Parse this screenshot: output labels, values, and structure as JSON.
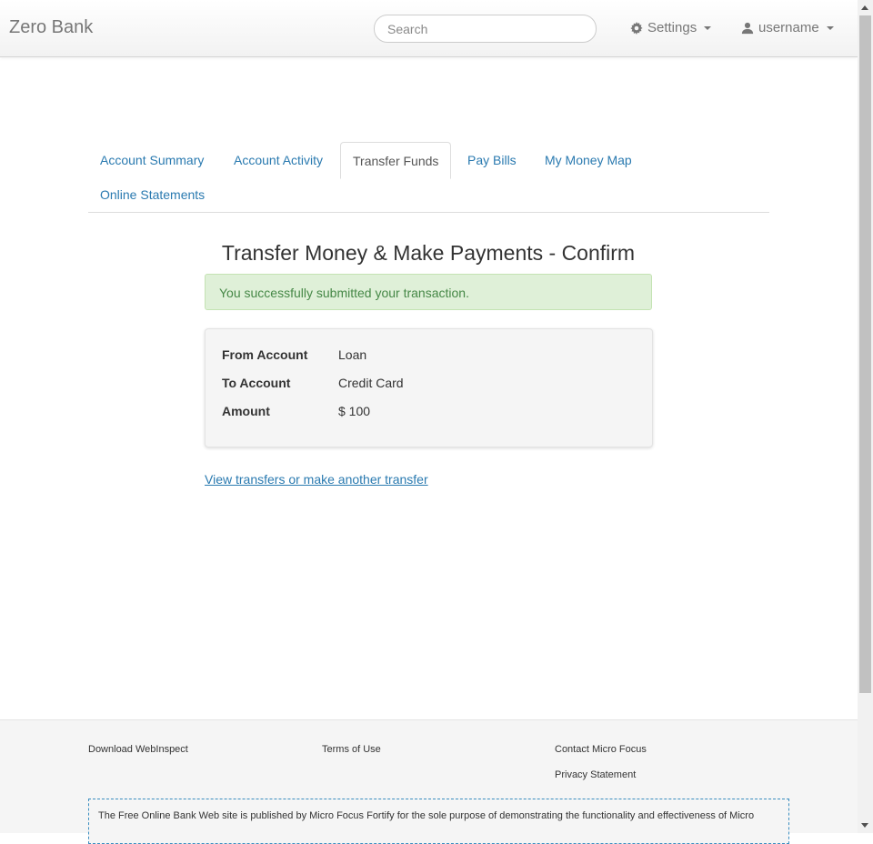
{
  "navbar": {
    "brand": "Zero Bank",
    "search_placeholder": "Search",
    "settings_label": "Settings",
    "user_label": "username"
  },
  "tabs": [
    {
      "label": "Account Summary"
    },
    {
      "label": "Account Activity"
    },
    {
      "label": "Transfer Funds",
      "active": true
    },
    {
      "label": "Pay Bills"
    },
    {
      "label": "My Money Map"
    },
    {
      "label": "Online Statements"
    }
  ],
  "main": {
    "title": "Transfer Money & Make Payments - Confirm",
    "alert": "You successfully submitted your transaction.",
    "details": [
      {
        "label": "From Account",
        "value": "Loan"
      },
      {
        "label": "To Account",
        "value": "Credit Card"
      },
      {
        "label": "Amount",
        "value": "$ 100"
      }
    ],
    "link": "View transfers or make another transfer"
  },
  "footer": {
    "download": "Download WebInspect",
    "terms": "Terms of Use",
    "contact": "Contact Micro Focus",
    "privacy": "Privacy Statement",
    "disclaimer": "The Free Online Bank Web site is published by Micro Focus Fortify for the sole purpose of demonstrating the functionality and effectiveness of Micro"
  },
  "colors": {
    "link": "#2a7ab0",
    "alert_bg": "#dff0d8",
    "alert_text": "#468847"
  }
}
